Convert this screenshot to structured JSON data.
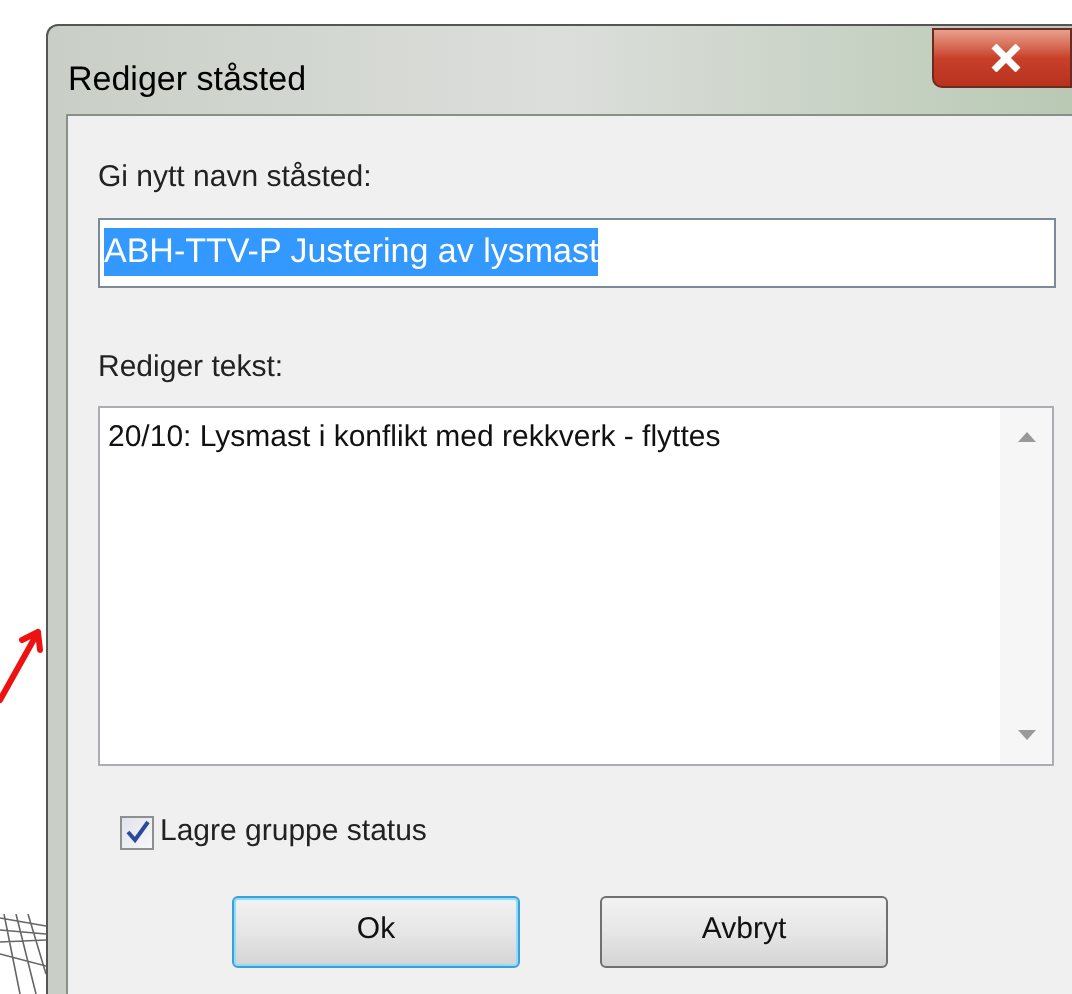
{
  "window": {
    "title": "Rediger ståsted"
  },
  "name_field": {
    "label": "Gi nytt navn ståsted:",
    "value": "ABH-TTV-P Justering av lysmast",
    "selected": true
  },
  "text_field": {
    "label": "Rediger tekst:",
    "value": "20/10: Lysmast i konflikt med rekkverk - flyttes"
  },
  "checkbox": {
    "label": "Lagre gruppe status",
    "checked": true
  },
  "buttons": [
    {
      "label": "Ok",
      "selected": true
    },
    {
      "label": "Avbryt",
      "selected": false
    }
  ]
}
